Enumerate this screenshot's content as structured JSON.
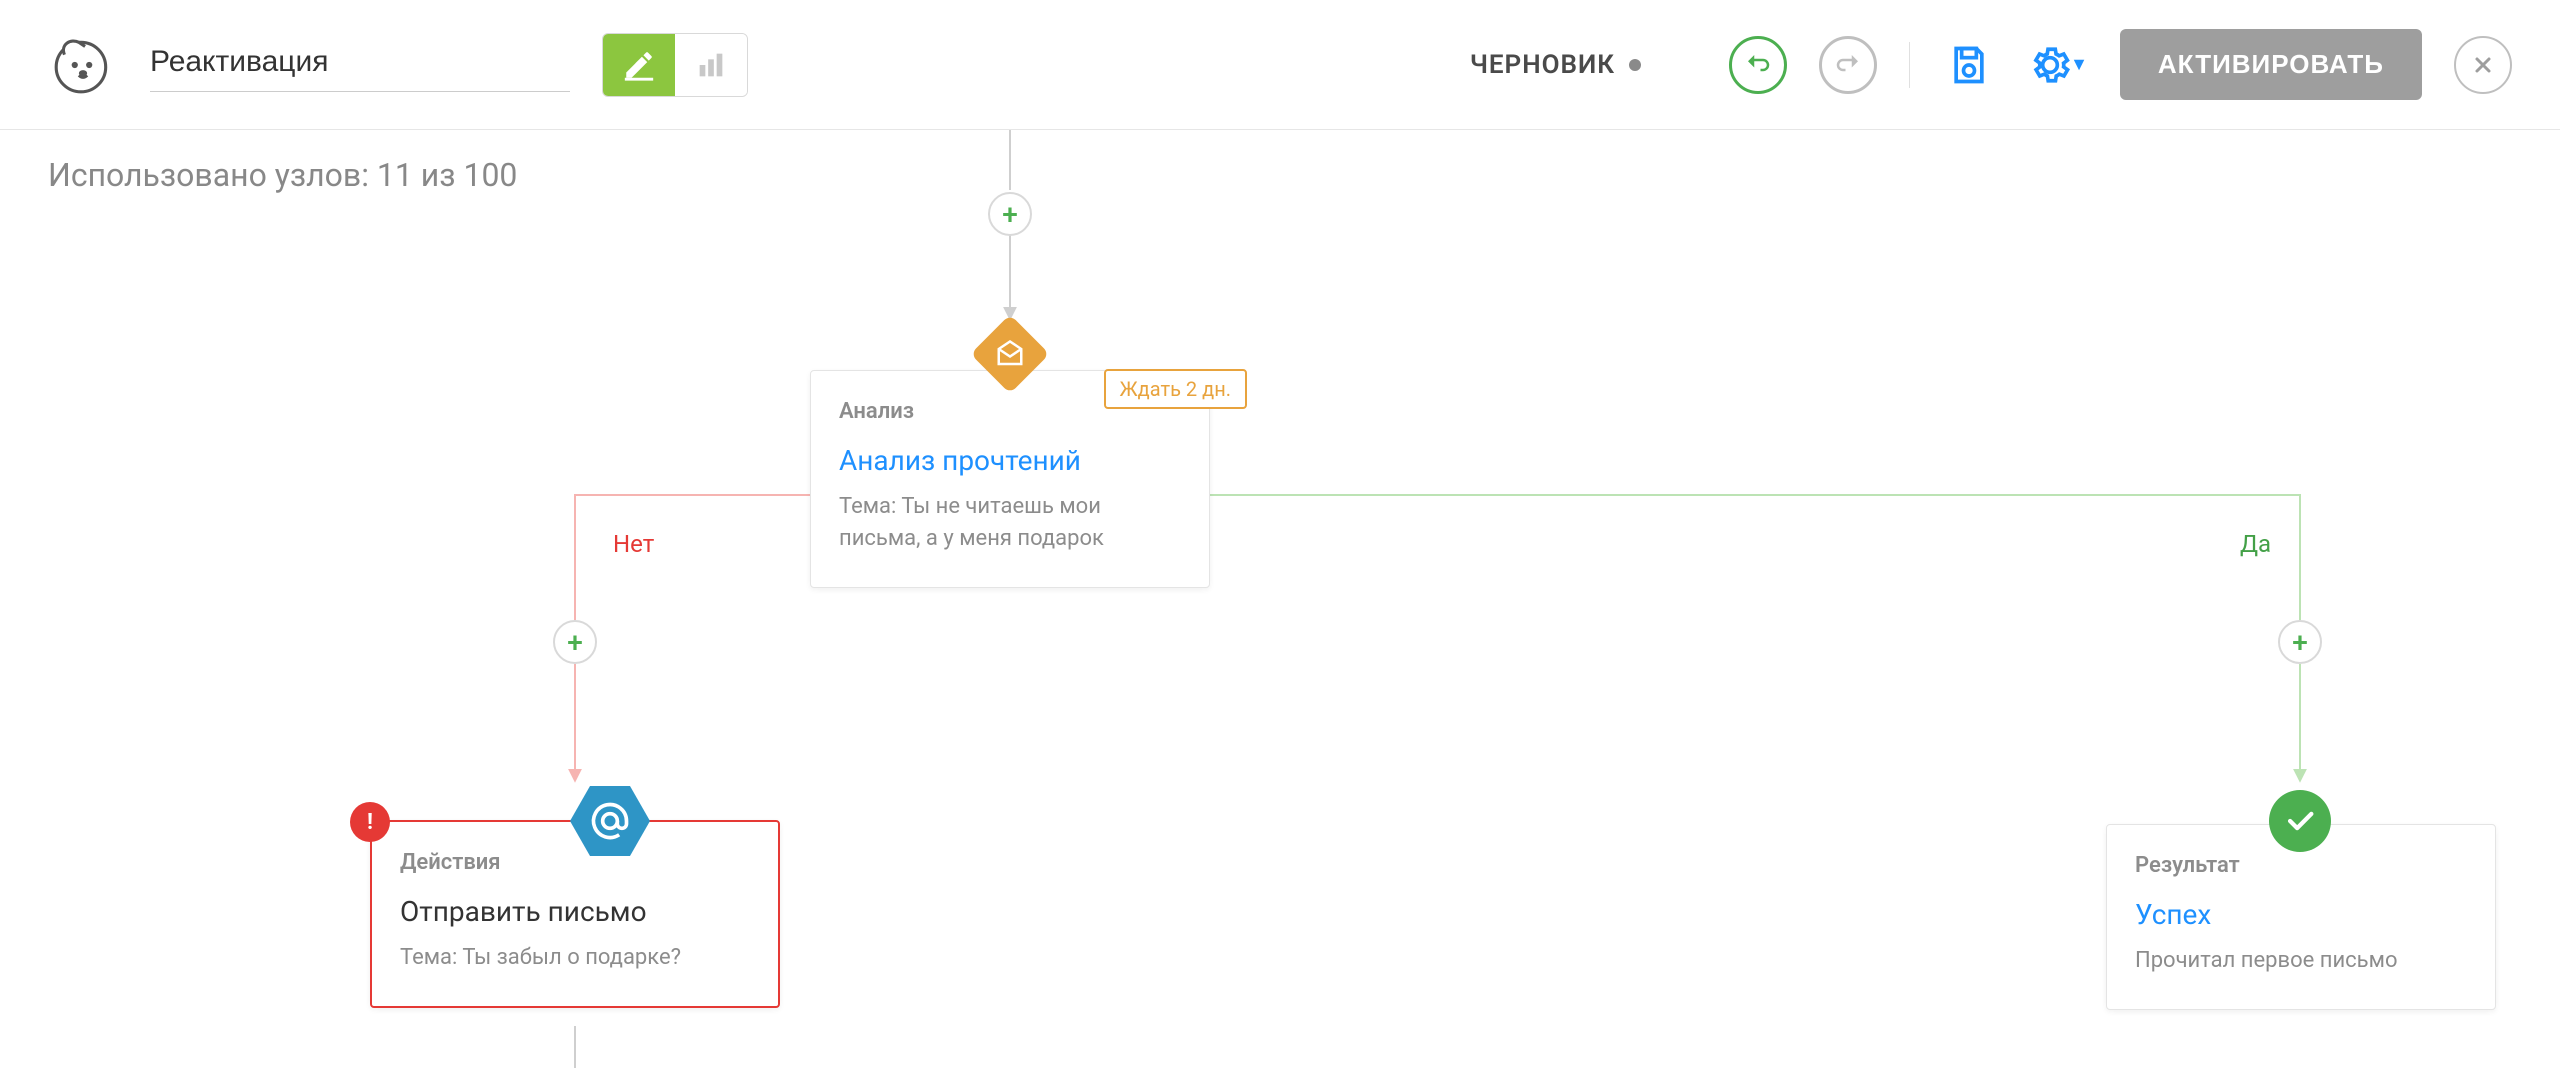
{
  "header": {
    "title": "Реактивация",
    "status_label": "ЧЕРНОВИК",
    "activate_label": "АКТИВИРОВАТЬ"
  },
  "usage": {
    "text": "Использовано узлов: 11 из 100"
  },
  "branches": {
    "no": "Нет",
    "yes": "Да"
  },
  "nodes": {
    "analysis": {
      "type": "Анализ",
      "title": "Анализ прочтений",
      "subtitle": "Тема: Ты не читаешь мои\nписьма, а у меня подарок",
      "wait": "Ждать 2 дн."
    },
    "action": {
      "type": "Действия",
      "title": "Отправить письмо",
      "subtitle": "Тема: Ты забыл о подарке?"
    },
    "result": {
      "type": "Результат",
      "title": "Успех",
      "subtitle": "Прочитал первое письмо"
    }
  }
}
